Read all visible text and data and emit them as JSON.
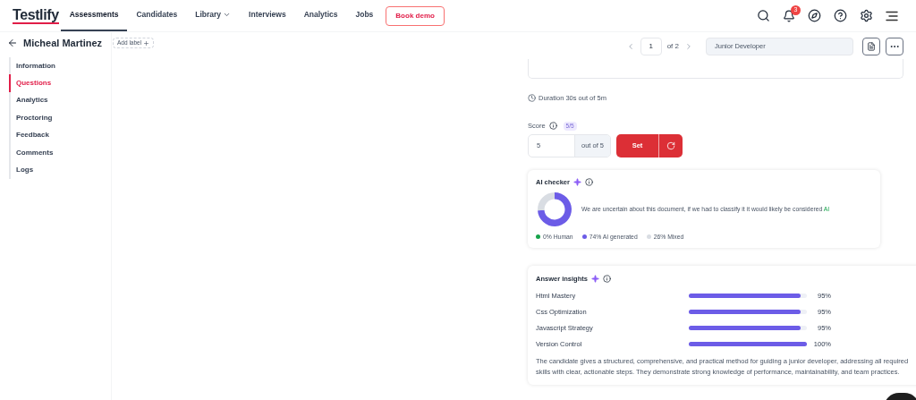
{
  "nav": {
    "logo": "Testlify",
    "items": [
      {
        "label": "Assessments",
        "selected": true,
        "dropdown": false
      },
      {
        "label": "Candidates",
        "selected": false,
        "dropdown": false
      },
      {
        "label": "Library",
        "selected": false,
        "dropdown": true
      },
      {
        "label": "Interviews",
        "selected": false,
        "dropdown": false
      },
      {
        "label": "Analytics",
        "selected": false,
        "dropdown": false
      },
      {
        "label": "Jobs",
        "selected": false,
        "dropdown": false
      }
    ],
    "cta": "Book demo",
    "notification_count": "3"
  },
  "header": {
    "candidate_name": "Micheal Martinez",
    "add_label": "Add label",
    "page": "1",
    "page_total": "of 2",
    "job": "Junior Developer"
  },
  "sidebar": {
    "items": [
      {
        "label": "Information",
        "selected": false
      },
      {
        "label": "Questions",
        "selected": true
      },
      {
        "label": "Analytics",
        "selected": false
      },
      {
        "label": "Proctoring",
        "selected": false
      },
      {
        "label": "Feedback",
        "selected": false
      },
      {
        "label": "Comments",
        "selected": false
      },
      {
        "label": "Logs",
        "selected": false
      }
    ]
  },
  "duration": "Duration 30s out of 5m",
  "score": {
    "label": "Score",
    "badge": "5/5",
    "value": "5",
    "out_of": "out of 5",
    "set_button": "Set"
  },
  "ai_checker": {
    "title": "AI checker",
    "message": "We are uncertain about this document, if we had to classify it it would likely be considered",
    "verdict": "AI",
    "legend": [
      {
        "percent": "0%",
        "color": "#16a34a"
      },
      {
        "percent": "74%",
        "color": "#6c5ce7"
      },
      {
        "percent": "26%",
        "color": "#d9dde3"
      }
    ],
    "chart_data": {
      "type": "donut",
      "categories": [
        "Human",
        "AI generated",
        "Mixed"
      ],
      "series": [
        {
          "values": [
            0,
            74,
            26
          ]
        }
      ]
    }
  },
  "answer_insights": {
    "title": "Answer insights",
    "skills": [
      {
        "name": "Html Mastery",
        "level": 0.95,
        "reading": "95%"
      },
      {
        "name": "Css Optimization",
        "level": 0.95,
        "reading": "95%"
      },
      {
        "name": "Javascript Strategy",
        "level": 0.95,
        "reading": "95%"
      },
      {
        "name": "Version Control",
        "level": 1,
        "reading": "100%"
      }
    ],
    "summary": "The candidate gives a structured, comprehensive, and practical method for guiding a junior developer, addressing all required skills with clear, actionable steps. They demonstrate strong knowledge of performance, maintainability, and team practices."
  }
}
